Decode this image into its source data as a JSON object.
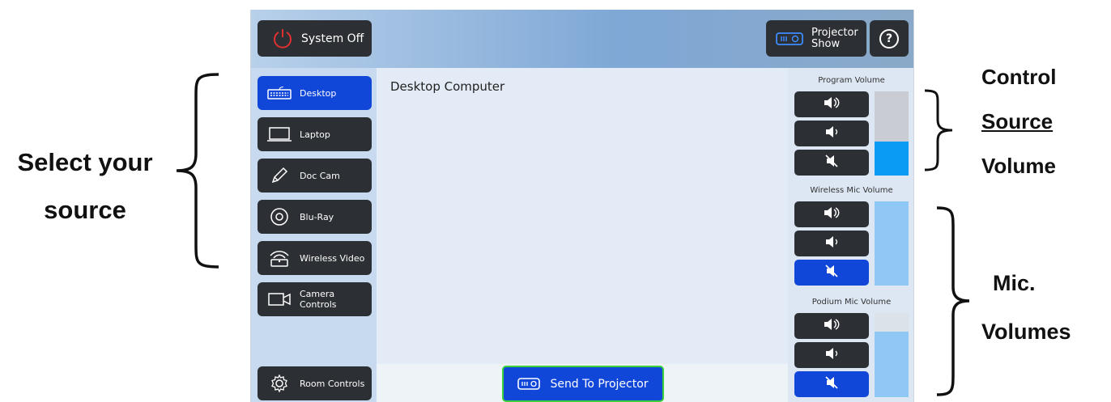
{
  "annotations": {
    "select_source": [
      "Select your",
      "source"
    ],
    "control_volume": [
      "Control",
      "Source",
      "Volume"
    ],
    "mic_volumes": [
      "Mic.",
      "Volumes"
    ]
  },
  "header": {
    "system_off_label": "System Off",
    "projector_show_label": [
      "Projector",
      "Show"
    ],
    "help_label": "?"
  },
  "sources": [
    {
      "label": "Desktop",
      "icon": "keyboard-icon",
      "active": true
    },
    {
      "label": "Laptop",
      "icon": "laptop-icon",
      "active": false
    },
    {
      "label": "Doc Cam",
      "icon": "pencil-icon",
      "active": false
    },
    {
      "label": "Blu-Ray",
      "icon": "disc-icon",
      "active": false
    },
    {
      "label": "Wireless Video",
      "icon": "wireless-icon",
      "active": false
    },
    {
      "label": "Camera Controls",
      "icon": "camera-icon",
      "active": false
    }
  ],
  "room_controls_label": "Room Controls",
  "main": {
    "source_title": "Desktop Computer",
    "send_label": "Send To Projector"
  },
  "volumes": [
    {
      "title": "Program Volume",
      "level": 0.4,
      "fill_color": "#0a9cf5",
      "mute_active": false
    },
    {
      "title": "Wireless Mic Volume",
      "level": 1.0,
      "fill_color": "#8fc8f4",
      "mute_active": true
    },
    {
      "title": "Podium Mic Volume",
      "level": 0.78,
      "fill_color": "#8fc8f4",
      "mute_active": true
    }
  ],
  "colors": {
    "accent": "#1147d9",
    "button_dark": "#2c2f33",
    "send_border": "#3ad13a"
  }
}
